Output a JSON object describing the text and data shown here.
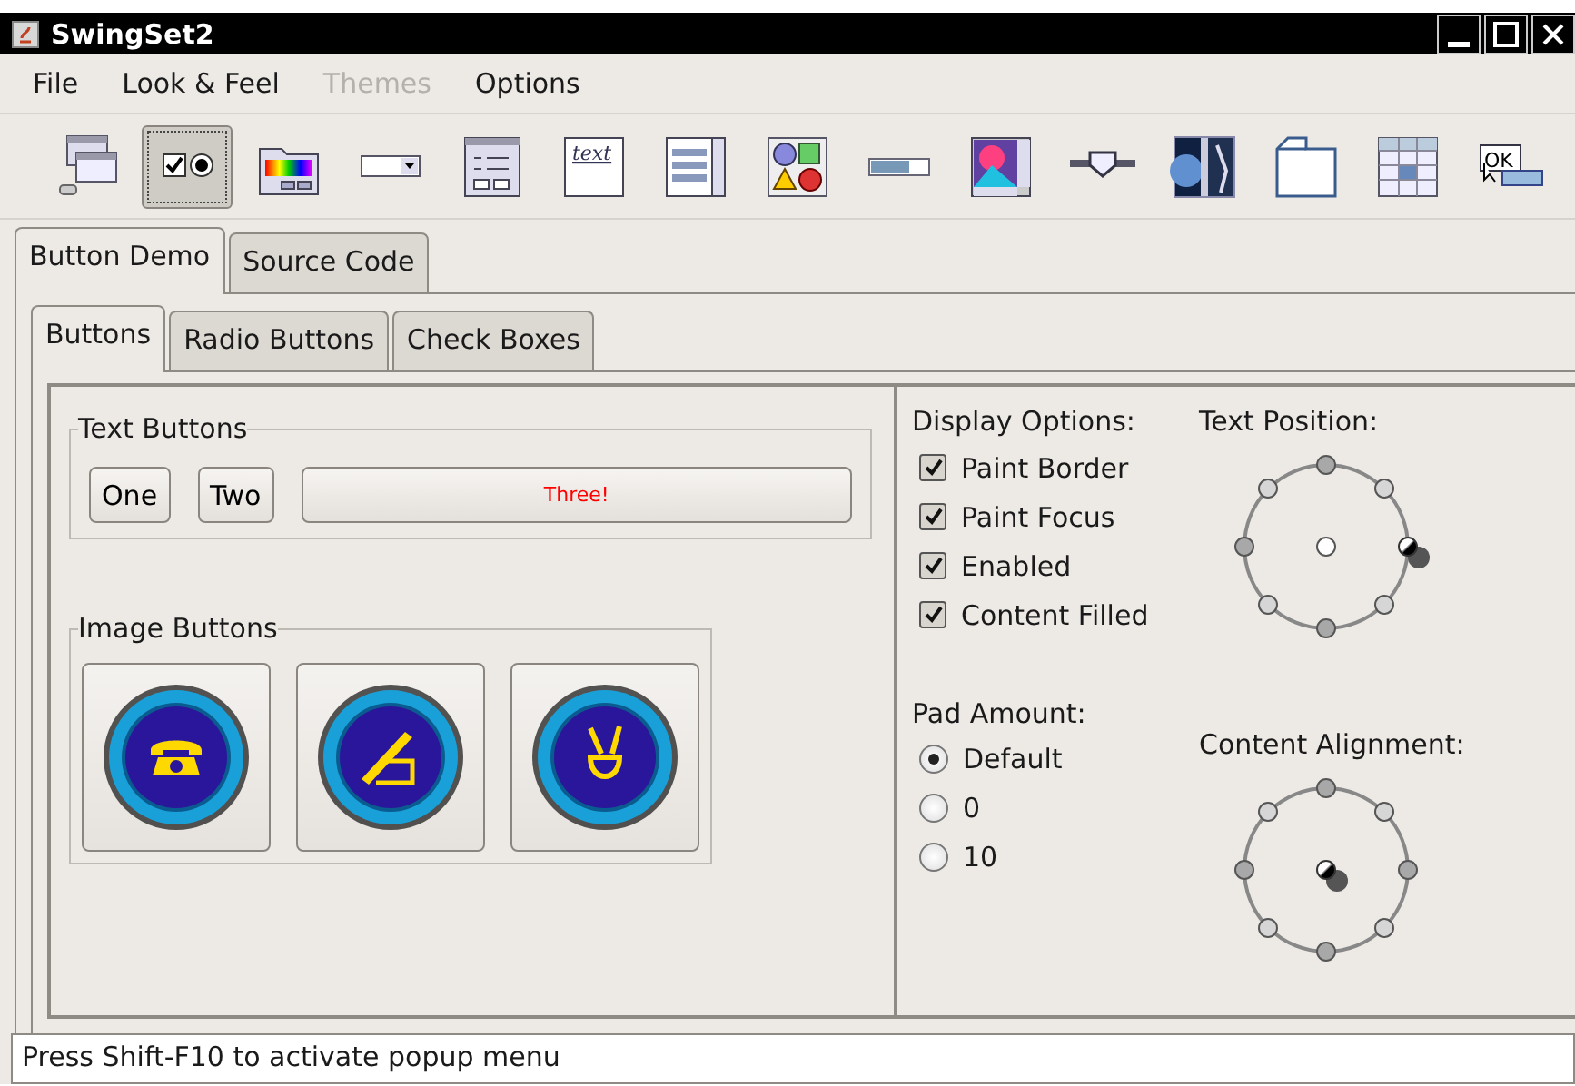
{
  "window": {
    "title": "SwingSet2"
  },
  "menu": [
    {
      "label": "File",
      "disabled": false
    },
    {
      "label": "Look & Feel",
      "disabled": false
    },
    {
      "label": "Themes",
      "disabled": true
    },
    {
      "label": "Options",
      "disabled": false
    }
  ],
  "toolbar": [
    {
      "kind": "frames",
      "selected": false
    },
    {
      "kind": "buttons",
      "selected": true
    },
    {
      "kind": "colors",
      "selected": false
    },
    {
      "kind": "combo",
      "selected": false
    },
    {
      "kind": "form",
      "selected": false
    },
    {
      "kind": "editor",
      "text": "text",
      "selected": false
    },
    {
      "kind": "list",
      "selected": false
    },
    {
      "kind": "alerts",
      "selected": false
    },
    {
      "kind": "progress",
      "selected": false
    },
    {
      "kind": "scroll",
      "selected": false
    },
    {
      "kind": "slider",
      "selected": false
    },
    {
      "kind": "split",
      "selected": false
    },
    {
      "kind": "tabs",
      "selected": false
    },
    {
      "kind": "table",
      "selected": false
    },
    {
      "kind": "tooltip",
      "text": "OK",
      "selected": false
    }
  ],
  "tabs": [
    {
      "label": "Button Demo",
      "selected": true
    },
    {
      "label": "Source Code",
      "selected": false
    }
  ],
  "subtabs": [
    {
      "label": "Buttons",
      "selected": true
    },
    {
      "label": "Radio Buttons",
      "selected": false
    },
    {
      "label": "Check Boxes",
      "selected": false
    }
  ],
  "text_buttons": {
    "title": "Text Buttons",
    "buttons": [
      {
        "label": "One",
        "color": "#000000"
      },
      {
        "label": "Two",
        "color": "#000000"
      },
      {
        "label": "Three!",
        "color": "#ff0000"
      }
    ]
  },
  "image_buttons": {
    "title": "Image Buttons",
    "buttons": [
      {
        "kind": "phone"
      },
      {
        "kind": "pen"
      },
      {
        "kind": "peace"
      }
    ]
  },
  "display_options": {
    "title": "Display Options:",
    "options": [
      {
        "label": "Paint Border",
        "checked": true
      },
      {
        "label": "Paint Focus",
        "checked": true
      },
      {
        "label": "Enabled",
        "checked": true
      },
      {
        "label": "Content Filled",
        "checked": true
      }
    ]
  },
  "text_position": {
    "title": "Text Position:",
    "positions": [
      {
        "selected": false
      },
      {
        "selected": false
      },
      {
        "selected": true
      },
      {
        "selected": false
      },
      {
        "selected": false
      },
      {
        "selected": false
      },
      {
        "selected": false
      },
      {
        "selected": false
      },
      {
        "selected": false
      }
    ]
  },
  "pad_amount": {
    "title": "Pad Amount:",
    "options": [
      {
        "label": "Default",
        "selected": true
      },
      {
        "label": "0",
        "selected": false
      },
      {
        "label": "10",
        "selected": false
      }
    ]
  },
  "content_alignment": {
    "title": "Content Alignment:",
    "positions": [
      {
        "selected": false
      },
      {
        "selected": false
      },
      {
        "selected": false
      },
      {
        "selected": false
      },
      {
        "selected": false
      },
      {
        "selected": false
      },
      {
        "selected": false
      },
      {
        "selected": false
      },
      {
        "selected": true
      }
    ]
  },
  "status_bar": {
    "text": "Press Shift-F10 to activate popup menu"
  }
}
